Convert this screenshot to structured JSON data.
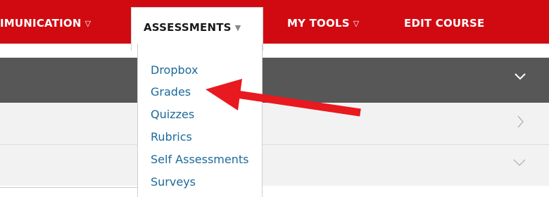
{
  "navbar": {
    "items": [
      {
        "label": "IMUNICATION",
        "has_dropdown": true
      },
      {
        "label": "ASSESSMENTS",
        "has_dropdown": true,
        "active": true
      },
      {
        "label": "MY TOOLS",
        "has_dropdown": true
      },
      {
        "label": "EDIT COURSE",
        "has_dropdown": false
      }
    ],
    "dropdown_glyph": "▽",
    "active_dropdown_glyph": "▼"
  },
  "dropdown": {
    "items": [
      "Dropbox",
      "Grades",
      "Quizzes",
      "Rubrics",
      "Self Assessments",
      "Surveys"
    ]
  },
  "colors": {
    "navbar_bg": "#d10a11",
    "link": "#1b6a9a",
    "annotation_arrow": "#e8191f"
  },
  "icons": {
    "panel1": "chevron-down-icon",
    "panel2": "chevron-right-icon",
    "panel3": "chevron-down-icon",
    "annotation": "red-arrow-pointing-left"
  }
}
